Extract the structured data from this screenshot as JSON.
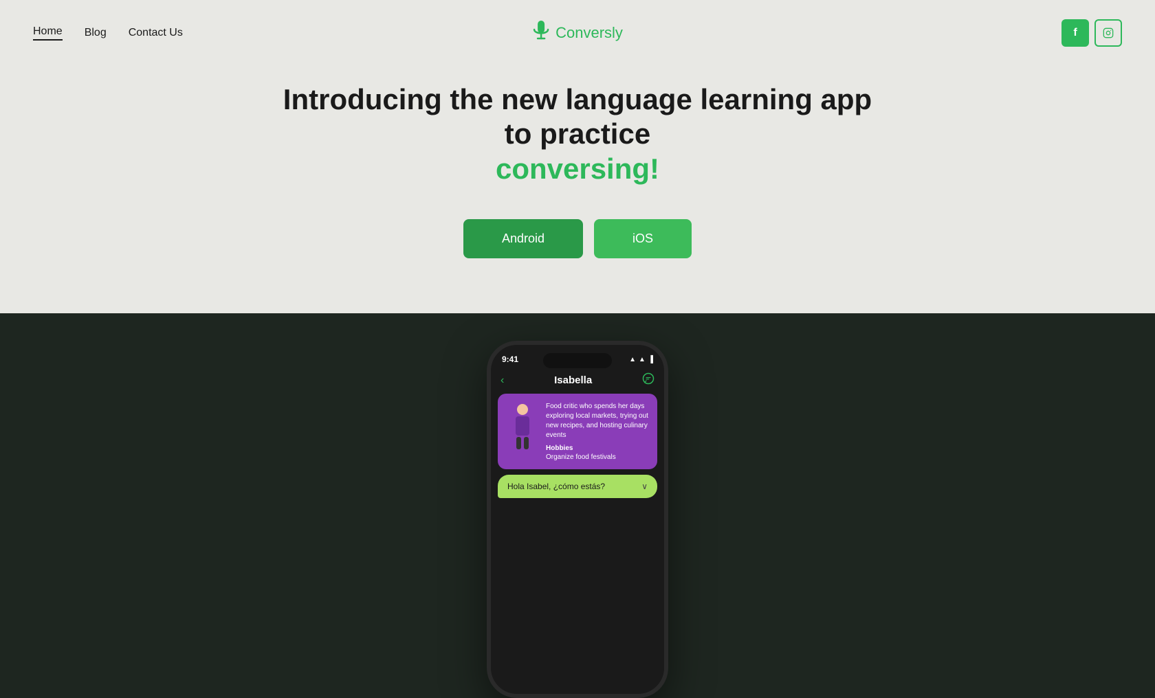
{
  "nav": {
    "home_label": "Home",
    "blog_label": "Blog",
    "contact_label": "Contact Us",
    "logo_text": "Conversly",
    "facebook_label": "f",
    "instagram_label": "ig"
  },
  "hero": {
    "headline_line1": "Introducing the new language learning app to practice",
    "headline_accent": "conversing!",
    "android_btn": "Android",
    "ios_btn": "iOS"
  },
  "phone": {
    "status_time": "9:41",
    "contact_name": "Isabella",
    "profile_desc": "Food critic who spends her days exploring local markets, trying out new recipes, and hosting culinary events",
    "hobbies_label": "Hobbies",
    "hobbies_value": "Organize food festivals",
    "chat_text": "Hola Isabel, ¿cómo estás?"
  },
  "colors": {
    "green_primary": "#2db85a",
    "green_dark": "#2a9948",
    "green_light": "#3dbb5a",
    "hero_bg": "#e8e8e4",
    "dark_bg": "#1e2620",
    "purple_card": "#8a3db8",
    "chat_bubble": "#a8e063"
  }
}
